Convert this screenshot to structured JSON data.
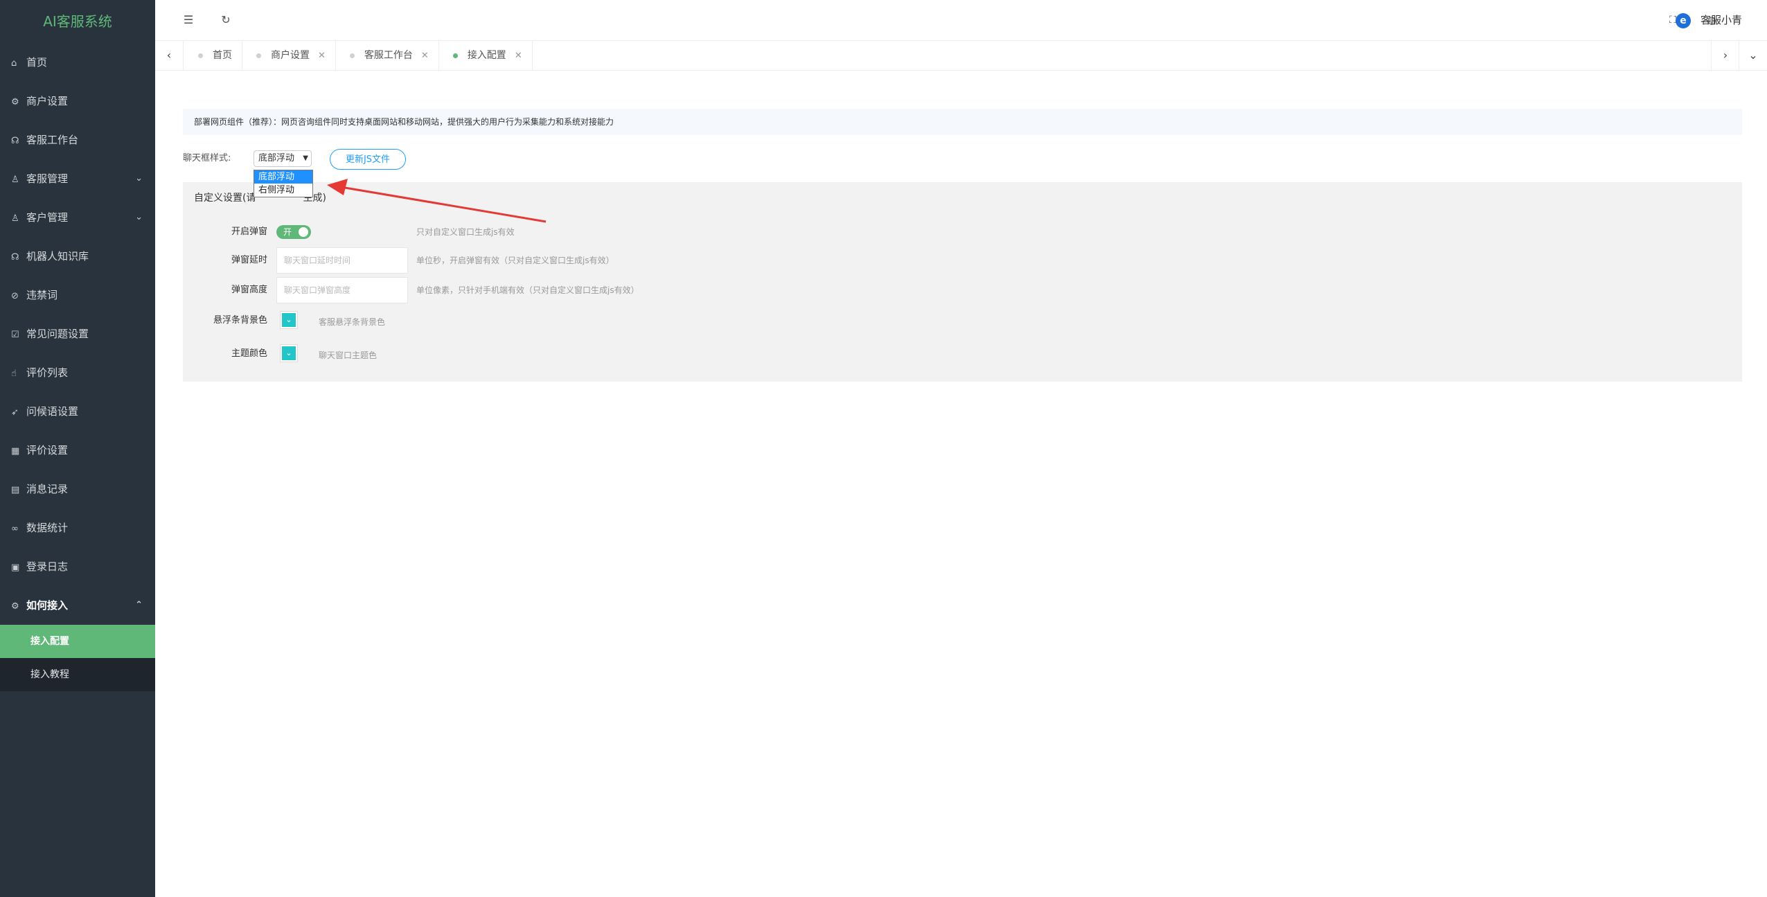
{
  "app": {
    "title": "AI客服系统"
  },
  "sidebar": {
    "items": [
      {
        "label": "首页",
        "icon": "home-icon",
        "glyph": "⌂"
      },
      {
        "label": "商户设置",
        "icon": "gear-icon",
        "glyph": "⚙"
      },
      {
        "label": "客服工作台",
        "icon": "headset-icon",
        "glyph": "☊"
      },
      {
        "label": "客服管理",
        "icon": "user-icon",
        "glyph": "♙",
        "chevron": "⌄"
      },
      {
        "label": "客户管理",
        "icon": "customers-icon",
        "glyph": "♙",
        "chevron": "⌄"
      },
      {
        "label": "机器人知识库",
        "icon": "robot-icon",
        "glyph": "☊"
      },
      {
        "label": "违禁词",
        "icon": "ban-icon",
        "glyph": "⊘"
      },
      {
        "label": "常见问题设置",
        "icon": "faq-icon",
        "glyph": "☑"
      },
      {
        "label": "评价列表",
        "icon": "thumbs-up-icon",
        "glyph": "☝"
      },
      {
        "label": "问候语设置",
        "icon": "send-icon",
        "glyph": "➶"
      },
      {
        "label": "评价设置",
        "icon": "calendar-icon",
        "glyph": "▦"
      },
      {
        "label": "消息记录",
        "icon": "document-icon",
        "glyph": "▤"
      },
      {
        "label": "数据统计",
        "icon": "link-icon",
        "glyph": "∞"
      },
      {
        "label": "登录日志",
        "icon": "log-icon",
        "glyph": "▣"
      },
      {
        "label": "如何接入",
        "icon": "plug-icon",
        "glyph": "⚙",
        "chevron": "⌃"
      }
    ],
    "subitems": [
      {
        "label": "接入配置",
        "active": true
      },
      {
        "label": "接入教程",
        "active": false
      }
    ]
  },
  "header": {
    "menu_toggle_glyph": "☰",
    "refresh_glyph": "↻",
    "fullscreen_glyph": "⛶",
    "language_glyph": "◍",
    "user_logo": "e",
    "user_name": "客服小青"
  },
  "tabs": {
    "prev_glyph": "‹",
    "next_glyph": "›",
    "more_glyph": "⌄",
    "close_glyph": "✕",
    "items": [
      {
        "label": "首页",
        "closable": false,
        "active": false
      },
      {
        "label": "商户设置",
        "closable": true,
        "active": false
      },
      {
        "label": "客服工作台",
        "closable": true,
        "active": false
      },
      {
        "label": "接入配置",
        "closable": true,
        "active": true
      }
    ]
  },
  "content": {
    "notice": "部署网页组件（推荐）：网页咨询组件同时支持桌面网站和移动网站，提供强大的用户行为采集能力和系统对接能力",
    "chat_style_label": "聊天框样式:",
    "chat_style_selected": "底部浮动",
    "chat_style_options": [
      "底部浮动",
      "右侧浮动"
    ],
    "update_js_button": "更新JS文件",
    "panel_title_left": "自定义设置(请",
    "panel_title_right": "生成)",
    "popup_label": "开启弹窗",
    "popup_switch_text": "开",
    "popup_hint": "只对自定义窗口生成js有效",
    "delay_label": "弹窗延时",
    "delay_placeholder": "聊天窗口延时时间",
    "delay_hint": "单位秒，开启弹窗有效（只对自定义窗口生成js有效）",
    "height_label": "弹窗高度",
    "height_placeholder": "聊天窗口弹窗高度",
    "height_hint": "单位像素，只针对手机端有效（只对自定义窗口生成js有效）",
    "float_bg_label": "悬浮条背景色",
    "float_bg_hint": "客服悬浮条背景色",
    "theme_label": "主题颜色",
    "theme_hint": "聊天窗口主题色"
  },
  "colors": {
    "sidebar_bg": "#28333e",
    "accent_green": "#5fb878",
    "accent_blue": "#1e9fff",
    "swatch": "#23c6c8",
    "arrow": "#e53935"
  }
}
